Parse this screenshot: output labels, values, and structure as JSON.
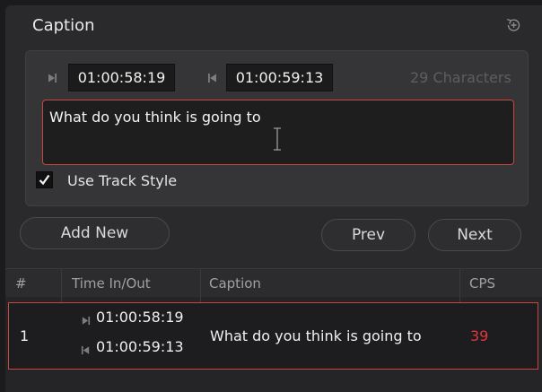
{
  "panel": {
    "title": "Caption",
    "reset_icon": "reset-icon"
  },
  "editor": {
    "time_in": "01:00:58:19",
    "time_out": "01:00:59:13",
    "in_icon": "mark-in-icon",
    "out_icon": "mark-out-icon",
    "char_count": "29 Characters",
    "caption_text": "What do you think is going to",
    "use_track_style": {
      "label": "Use Track Style",
      "checked": true
    }
  },
  "buttons": {
    "add_new": "Add New",
    "prev": "Prev",
    "next": "Next"
  },
  "table": {
    "columns": [
      "#",
      "Time In/Out",
      "Caption",
      "CPS"
    ],
    "rows": [
      {
        "index": "1",
        "time_in": "01:00:58:19",
        "time_out": "01:00:59:13",
        "caption": "What do you think is going to",
        "cps": "39"
      }
    ]
  },
  "colors": {
    "accent_red": "#c8473f",
    "cps_warning": "#e2353d",
    "panel_bg": "#2a2a2c"
  }
}
